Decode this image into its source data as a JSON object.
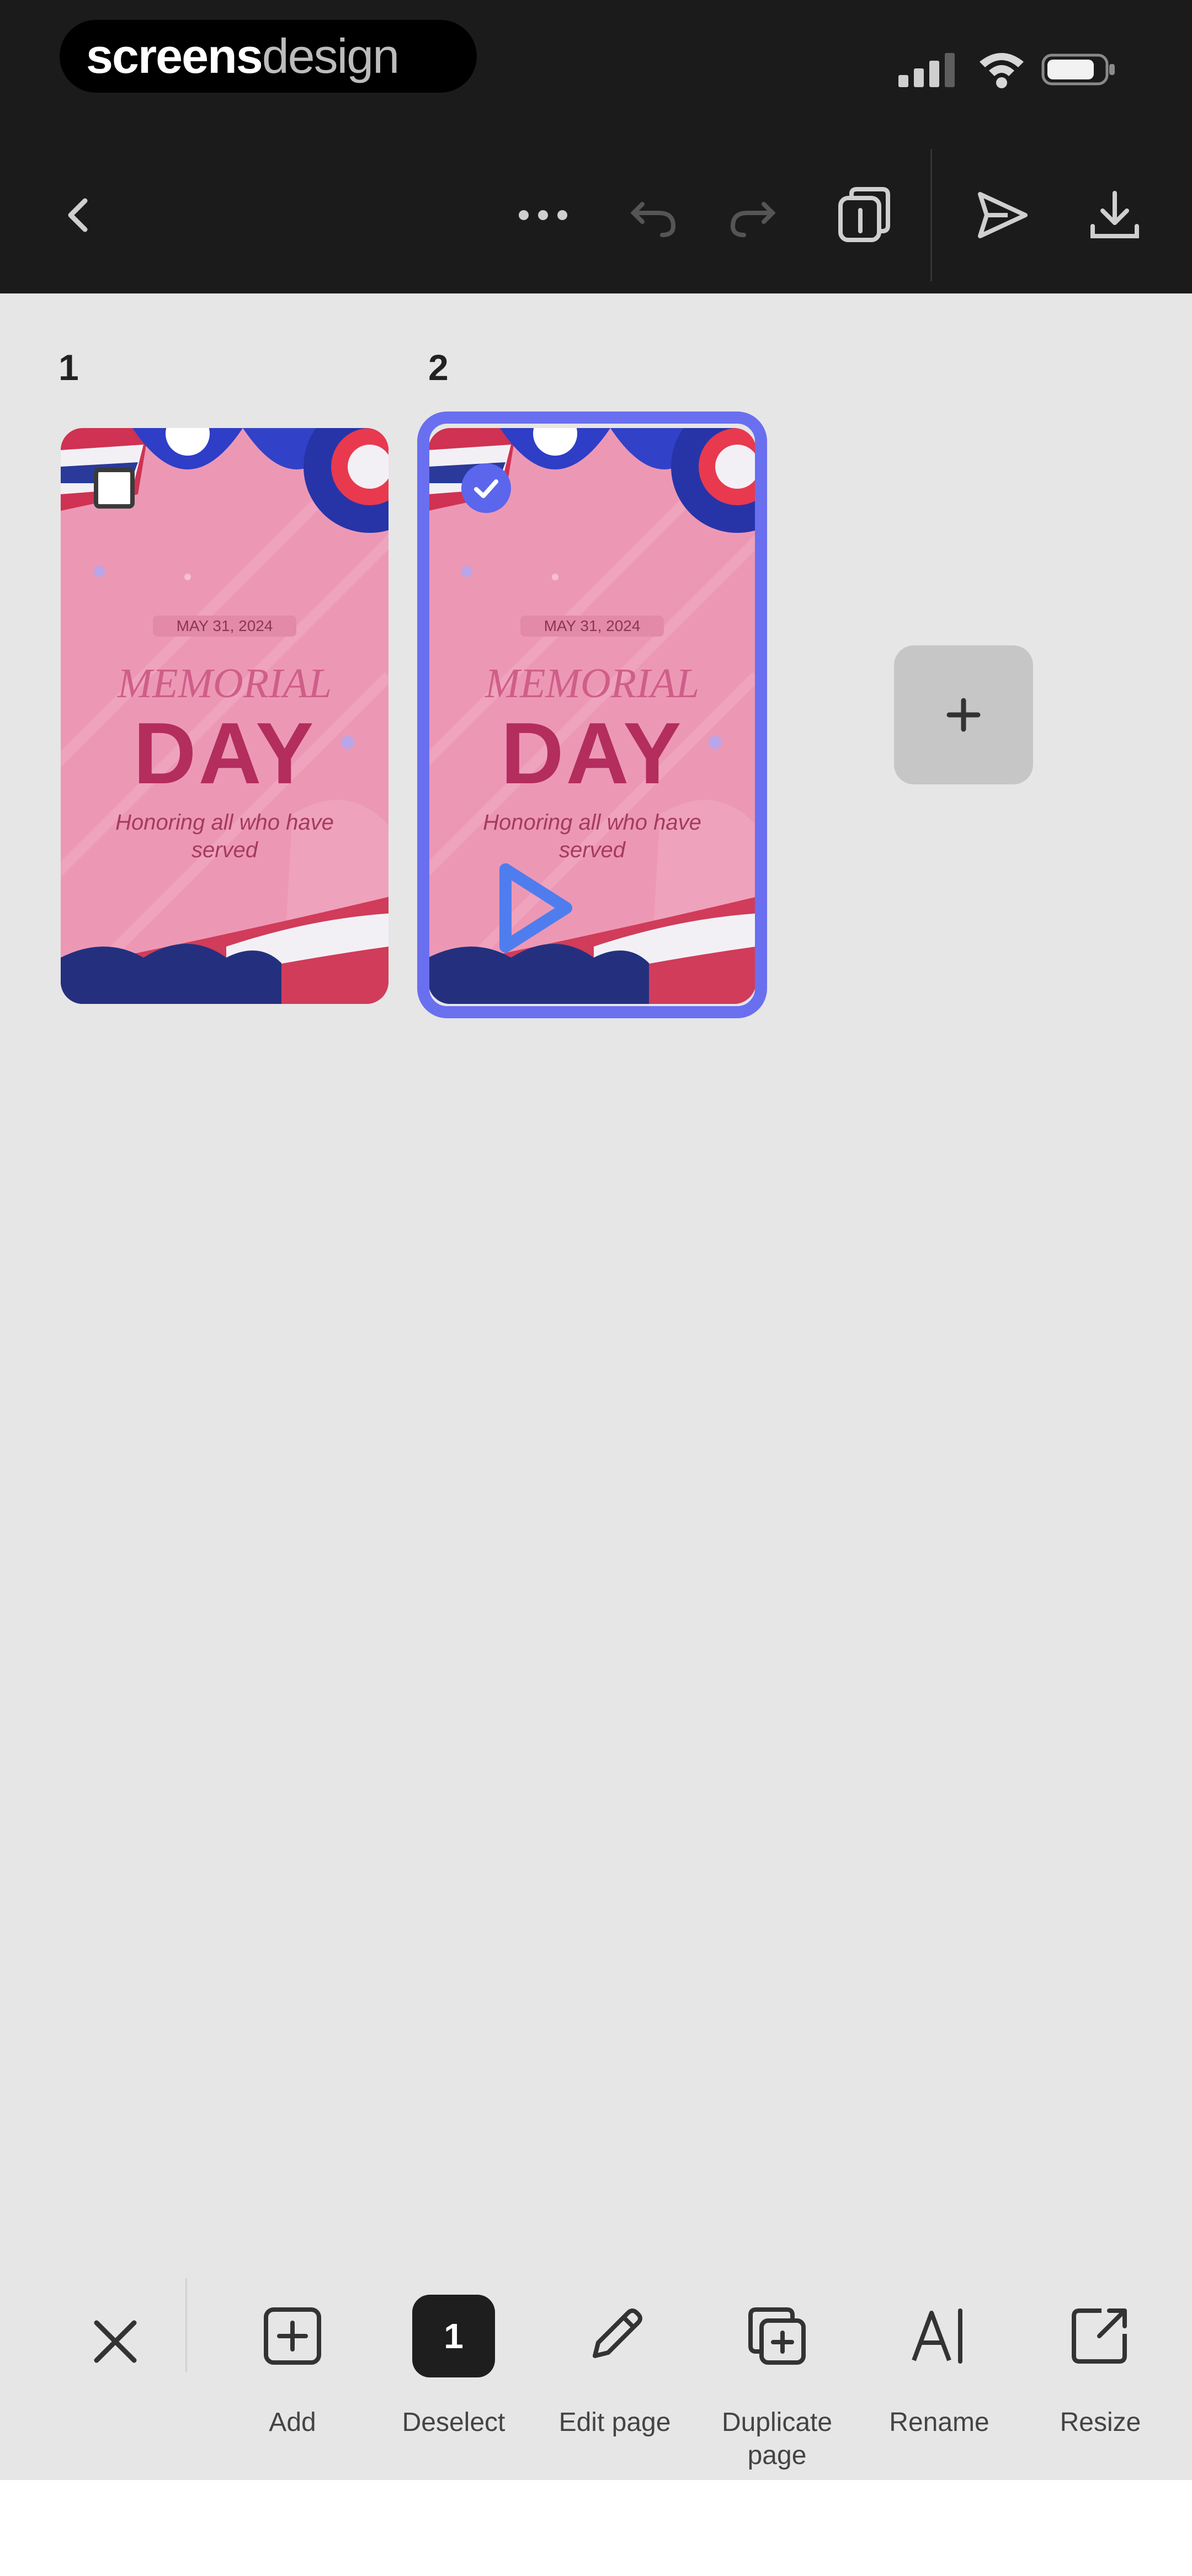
{
  "brand": {
    "part1": "screens",
    "part2": "design"
  },
  "toolbar": {
    "back": "back-icon",
    "more": "more-icon",
    "undo": "undo-icon",
    "redo": "redo-icon",
    "pages": "pages-icon",
    "share": "share-icon",
    "download": "download-icon"
  },
  "pages": [
    {
      "number": "1",
      "selected": false,
      "date": "MAY 31, 2024",
      "title1": "MEMORIAL",
      "title2": "DAY",
      "subtitle": "Honoring all who have served"
    },
    {
      "number": "2",
      "selected": true,
      "date": "MAY 31, 2024",
      "title1": "MEMORIAL",
      "title2": "DAY",
      "subtitle": "Honoring all who have served"
    }
  ],
  "bottom_toolbar": {
    "close": "close-icon",
    "items": [
      {
        "label": "Add",
        "icon": "add-page-icon"
      },
      {
        "label": "Deselect",
        "icon": "selection-count-badge",
        "count": "1"
      },
      {
        "label": "Edit page",
        "icon": "pencil-icon"
      },
      {
        "label": "Duplicate page",
        "icon": "duplicate-icon"
      },
      {
        "label": "Rename",
        "icon": "rename-icon"
      },
      {
        "label": "Resize",
        "icon": "resize-icon"
      }
    ]
  },
  "colors": {
    "header": "#1b1b1b",
    "canvas": "#e6e6e6",
    "selection": "#6a6ff0",
    "thumb_pink": "#ec98b5",
    "title_red": "#b32d5d"
  }
}
